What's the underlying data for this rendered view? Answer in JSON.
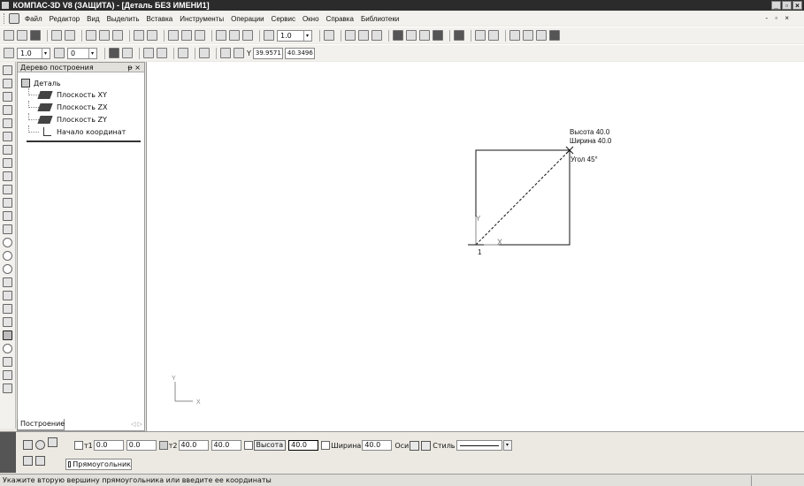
{
  "window": {
    "title": "КОМПАС-3D V8 (ЗАЩИТА) - [Деталь БЕЗ ИМЕНИ1]",
    "min": "_",
    "max": "▫",
    "close": "×"
  },
  "menu": {
    "items": [
      "Файл",
      "Редактор",
      "Вид",
      "Выделить",
      "Вставка",
      "Инструменты",
      "Операции",
      "Сервис",
      "Окно",
      "Справка",
      "Библиотеки"
    ],
    "mdi_controls": "- ▫ ×"
  },
  "toolbar1": {
    "zoom_value": "1.0"
  },
  "toolbar2": {
    "step_value": "1.0",
    "angle_value": "0",
    "coord_label": "Y",
    "coord_x": "39.9571",
    "coord_y": "40.3496"
  },
  "tree": {
    "header": "Дерево построения",
    "header_btns": "ᵽ ×",
    "root": "Деталь",
    "items": [
      "Плоскость XY",
      "Плоскость ZX",
      "Плоскость ZY",
      "Начало координат"
    ],
    "tab": "Построение",
    "tab_arrows": "◁ ▷"
  },
  "canvas": {
    "annotation_height": "Высота 40.0",
    "annotation_width": "Ширина 40.0",
    "annotation_angle": "Угол 45°",
    "axis_y": "Y",
    "axis_x": "X",
    "origin_label": "1",
    "corner_axis_y": "Y",
    "corner_axis_x": "X"
  },
  "props": {
    "p1_label": "т1",
    "p1_x": "0.0",
    "p1_y": "0.0",
    "p2_label": "т2",
    "p2_x": "40.0",
    "p2_y": "40.0",
    "height_label": "Высота",
    "height_value": "40.0",
    "width_label": "Ширина",
    "width_value": "40.0",
    "axes_label": "Оси",
    "style_label": "Стиль",
    "style_dd": "▾",
    "tab": "Прямоугольник"
  },
  "status": {
    "text": "Укажите вторую вершину прямоугольника или введите ее координаты"
  }
}
